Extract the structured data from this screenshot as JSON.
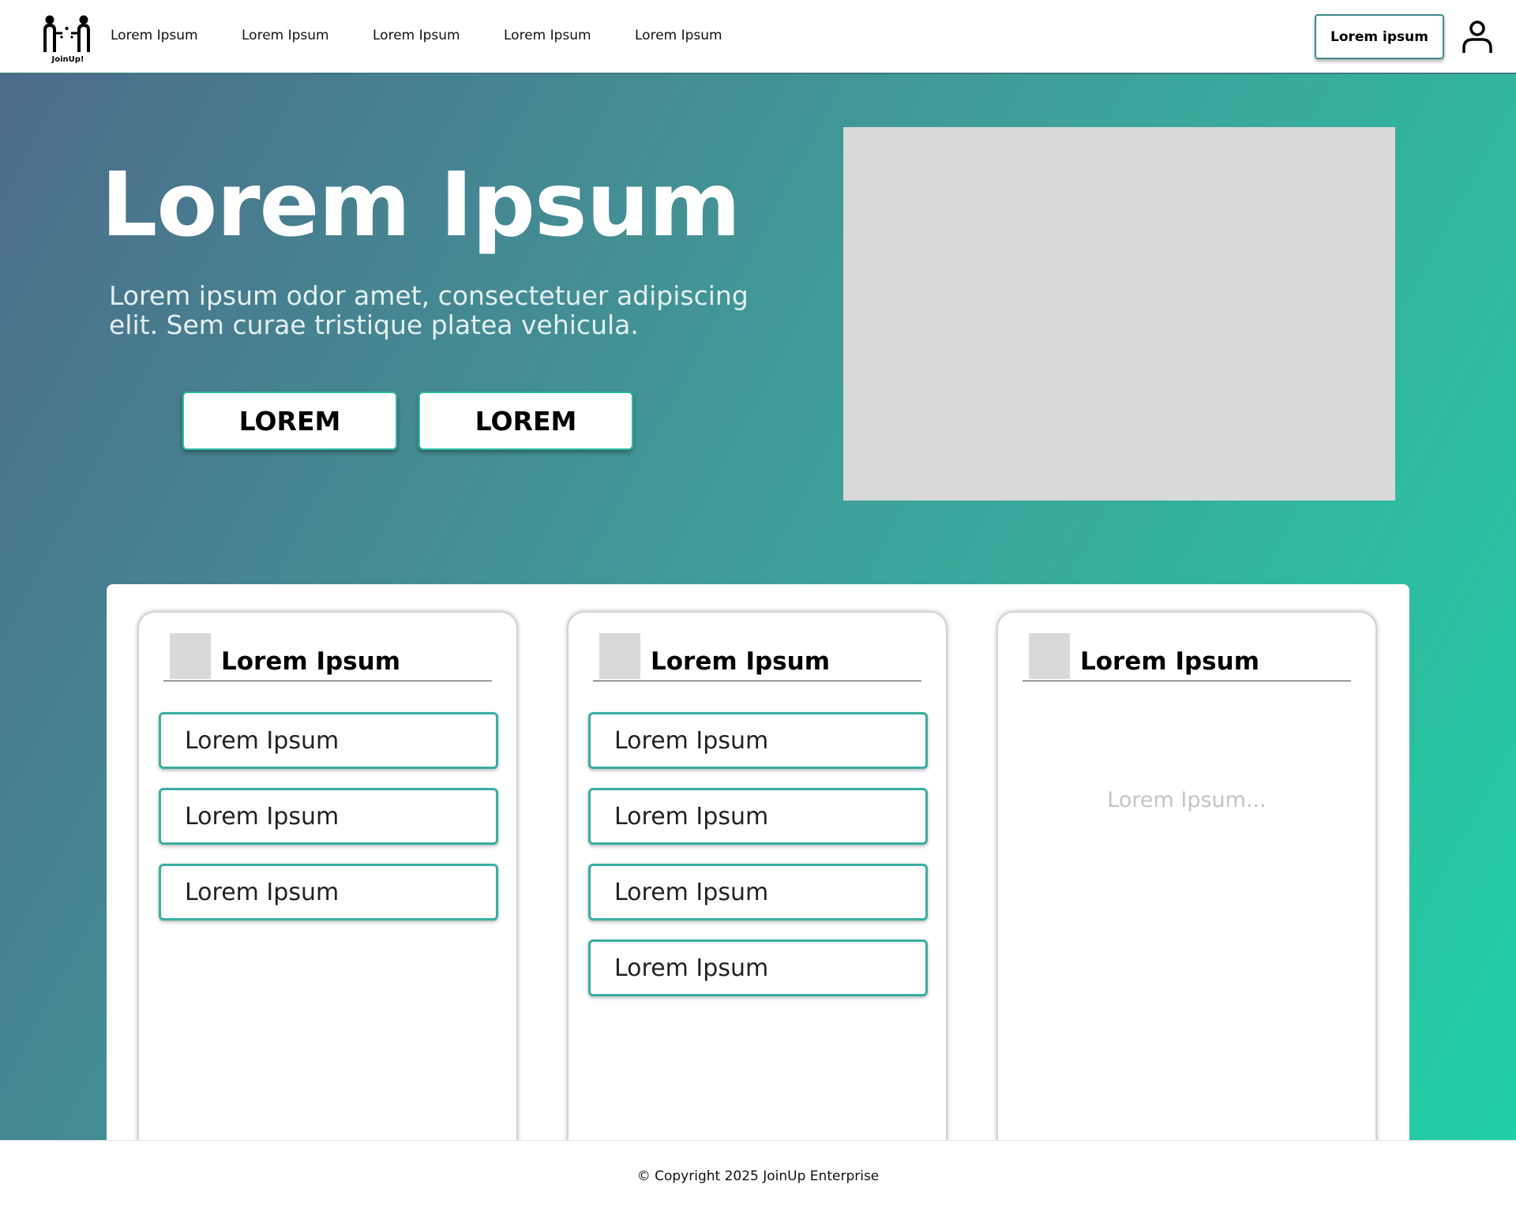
{
  "header": {
    "logo_text": "JoinUp!",
    "nav": [
      "Lorem Ipsum",
      "Lorem Ipsum",
      "Lorem Ipsum",
      "Lorem Ipsum",
      "Lorem Ipsum"
    ],
    "cta_label": "Lorem ipsum",
    "user_icon": "user-icon"
  },
  "hero": {
    "title": "Lorem Ipsum",
    "subtitle": "Lorem ipsum odor amet, consectetuer adipiscing elit. Sem curae tristique platea vehicula.",
    "buttons": [
      "LOREM",
      "LOREM"
    ]
  },
  "cards": [
    {
      "title": "Lorem Ipsum",
      "items": [
        "Lorem Ipsum",
        "Lorem Ipsum",
        "Lorem Ipsum"
      ]
    },
    {
      "title": "Lorem Ipsum",
      "items": [
        "Lorem Ipsum",
        "Lorem Ipsum",
        "Lorem Ipsum",
        "Lorem Ipsum"
      ]
    },
    {
      "title": "Lorem Ipsum",
      "placeholder": "Lorem Ipsum..."
    }
  ],
  "footer": {
    "copyright": "© Copyright 2025 JoinUp Enterprise"
  },
  "colors": {
    "gradient_start": "#4c6c8a",
    "gradient_end": "#22cfa7",
    "accent_teal": "#3aaea0",
    "placeholder_gray": "#d9d9d9"
  }
}
